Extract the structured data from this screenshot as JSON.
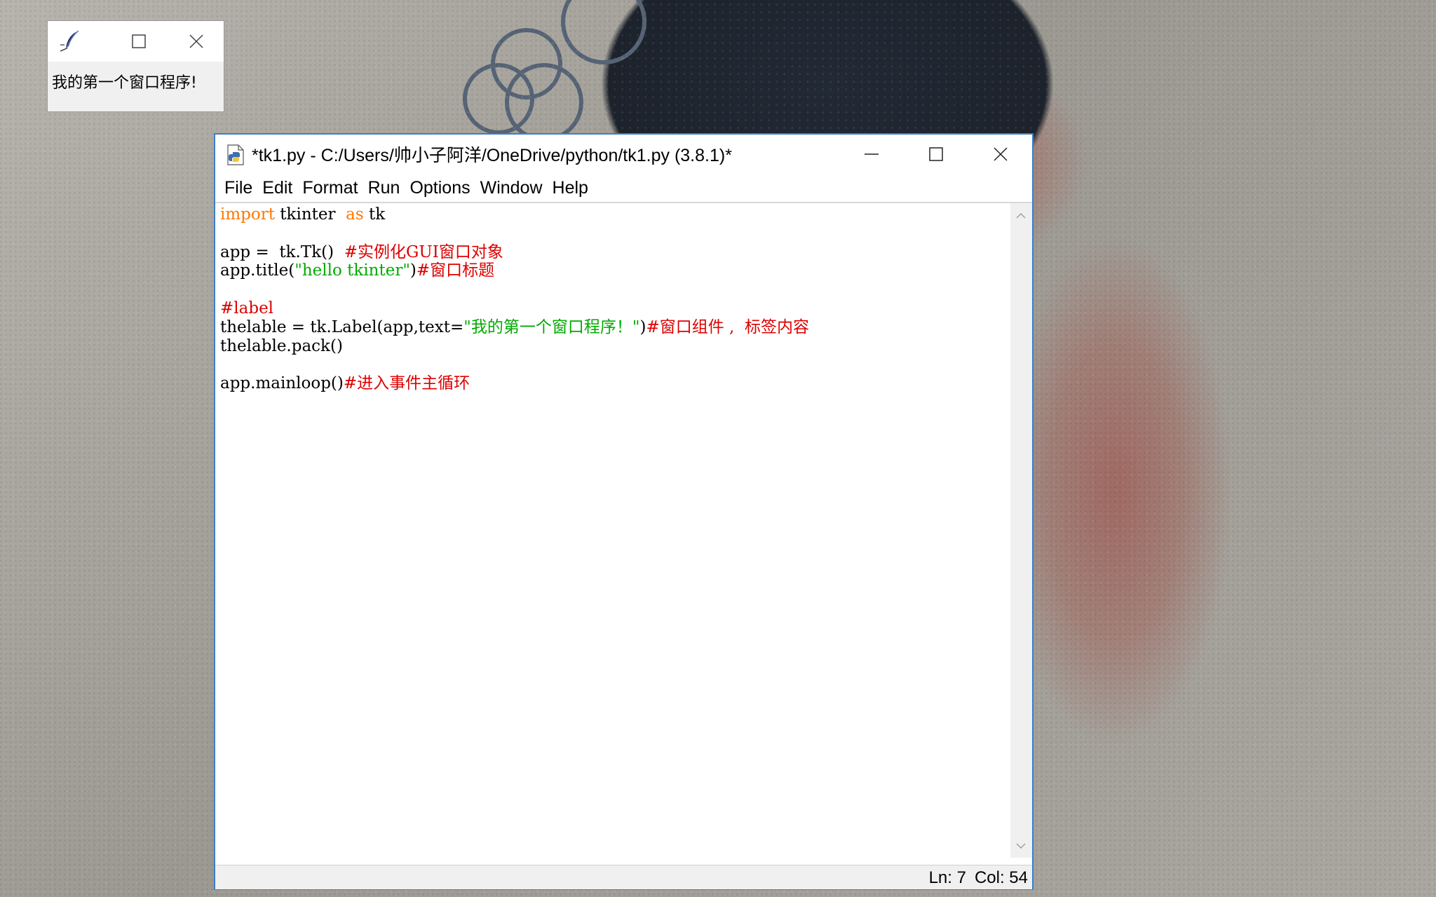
{
  "desktop": {
    "wallpaper": "photo-wallpaper"
  },
  "tk_window": {
    "title_icon": "feather-icon",
    "label_text": "我的第一个窗口程序!"
  },
  "idle_window": {
    "title": "*tk1.py - C:/Users/帅小子阿洋/OneDrive/python/tk1.py (3.8.1)*",
    "app_icon": "python-file-icon",
    "menu": [
      "File",
      "Edit",
      "Format",
      "Run",
      "Options",
      "Window",
      "Help"
    ],
    "code_lines": [
      [
        {
          "t": "import",
          "c": "kw"
        },
        {
          "t": " tkinter  ",
          "c": ""
        },
        {
          "t": "as",
          "c": "kw"
        },
        {
          "t": " tk",
          "c": ""
        }
      ],
      [],
      [
        {
          "t": "app =  tk.Tk()  ",
          "c": ""
        },
        {
          "t": "#实例化GUI窗口对象",
          "c": "com"
        }
      ],
      [
        {
          "t": "app.title(",
          "c": ""
        },
        {
          "t": "\"hello tkinter\"",
          "c": "str"
        },
        {
          "t": ")",
          "c": ""
        },
        {
          "t": "#窗口标题",
          "c": "com"
        }
      ],
      [],
      [
        {
          "t": "#label",
          "c": "com"
        }
      ],
      [
        {
          "t": "thelable = tk.Label(app,text=",
          "c": ""
        },
        {
          "t": "\"我的第一个窗口程序！\"",
          "c": "str"
        },
        {
          "t": ")",
          "c": ""
        },
        {
          "t": "#窗口组件 ,  标签内容",
          "c": "com"
        }
      ],
      [
        {
          "t": "thelable.pack()",
          "c": ""
        }
      ],
      [],
      [
        {
          "t": "app.mainloop()",
          "c": ""
        },
        {
          "t": "#进入事件主循环",
          "c": "com"
        }
      ]
    ],
    "status": {
      "ln": "Ln: 7",
      "col": "Col: 54"
    }
  },
  "colors": {
    "keyword": "#ff7700",
    "string": "#00aa00",
    "comment": "#dd0000",
    "window_border": "#3b7ec8"
  }
}
